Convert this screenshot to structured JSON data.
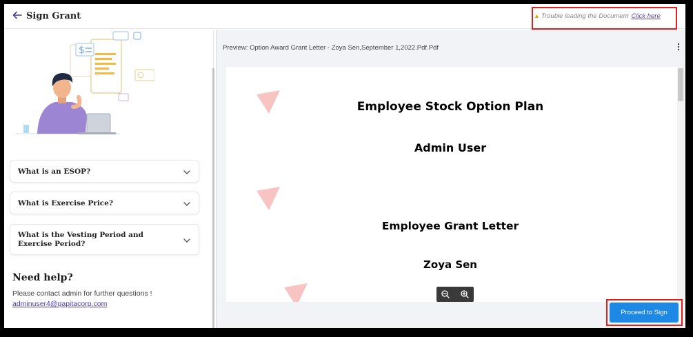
{
  "header": {
    "title": "Sign Grant",
    "trouble_text": "Trouble loading the Document",
    "trouble_link": "Click here"
  },
  "faqs": [
    {
      "question": "What is an ESOP?"
    },
    {
      "question": "What is Exercise Price?"
    },
    {
      "question": "What is the Vesting Period and Exercise Period?"
    }
  ],
  "help": {
    "title": "Need help?",
    "text": "Please contact admin for further questions !",
    "email": "adminuser4@qapitacorp.com"
  },
  "preview": {
    "label": "Preview: Option Award Grant Letter - Zoya Sen,September 1,2022.Pdf.Pdf",
    "document": {
      "line1": "Employee Stock Option Plan",
      "line2": "Admin User",
      "line3": "Employee Grant Letter",
      "line4": "Zoya Sen"
    }
  },
  "actions": {
    "proceed_label": "Proceed to Sign"
  },
  "colors": {
    "accent": "#1e88e5",
    "highlight_border": "#e0201c",
    "link": "#4a3bb0",
    "watermark": "#f7b8b8"
  }
}
